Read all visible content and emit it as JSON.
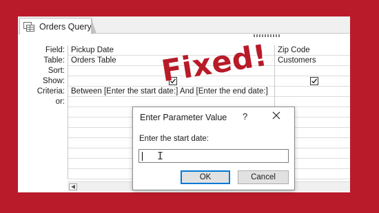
{
  "tab": {
    "icon": "query-icon",
    "label": "Orders Query"
  },
  "grid": {
    "row_labels": [
      "Field:",
      "Table:",
      "Sort:",
      "Show:",
      "Criteria:",
      "or:"
    ],
    "column1": {
      "field": "Pickup Date",
      "table": "Orders Table",
      "sort": "",
      "show": true,
      "criteria": "Between [Enter the start date:] And [Enter the end date:]",
      "or": ""
    },
    "column2": {
      "field": "Zip Code",
      "table": "Customers",
      "sort": "",
      "show": true,
      "criteria": "",
      "or": ""
    }
  },
  "overlay": {
    "stamp_text": "Fixed!",
    "stamp_color": "#b81b28"
  },
  "dialog": {
    "title": "Enter Parameter Value",
    "help": "?",
    "prompt": "Enter the start date:",
    "input_value": "",
    "ok_label": "OK",
    "cancel_label": "Cancel"
  },
  "colors": {
    "background": "#ba1b2a",
    "accent": "#0078d7"
  }
}
